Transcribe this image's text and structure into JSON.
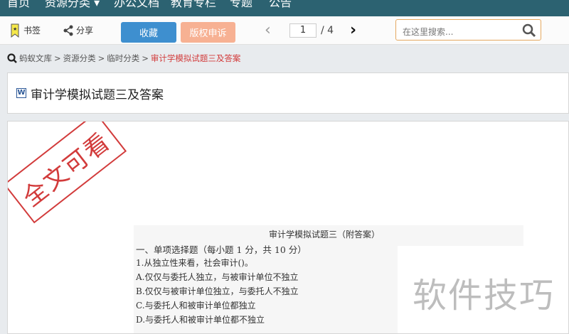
{
  "nav": {
    "items": [
      "首页",
      "资源分类 ▾",
      "办公文档",
      "教育专栏",
      "专题",
      "公告"
    ]
  },
  "toolbar": {
    "bookmark": "书签",
    "share": "分享",
    "favorite": "收藏",
    "copyright": "版权申诉",
    "page_current": "1",
    "page_total": "/ 4",
    "search_placeholder": "在这里搜索..."
  },
  "breadcrumb": [
    "蚂蚁文库",
    ">",
    "资源分类",
    ">",
    "临时分类",
    ">",
    "审计学模拟试题三及答案"
  ],
  "title": "审计学模拟试题三及答案",
  "doc": {
    "stamp": "全文可看",
    "watermark": "软件技巧",
    "lines": [
      "审计学模拟试题三（附答案）",
      "一、单项选择题（每小题 1 分，共 10 分）",
      "1.从独立性来看，社会审计()。",
      "A.仅仅与委托人独立，与被审计单位不独立",
      "B.仅仅与被审计单位独立，与委托人不独立",
      "C.与委托人和被审计单位都独立",
      "D.与委托人和被审计单位都不独立"
    ]
  },
  "colors": {
    "nav": "#2c6271",
    "favorite": "#3e8fcf",
    "copyright": "#f7b193",
    "crumb_active": "#d23b3b"
  }
}
